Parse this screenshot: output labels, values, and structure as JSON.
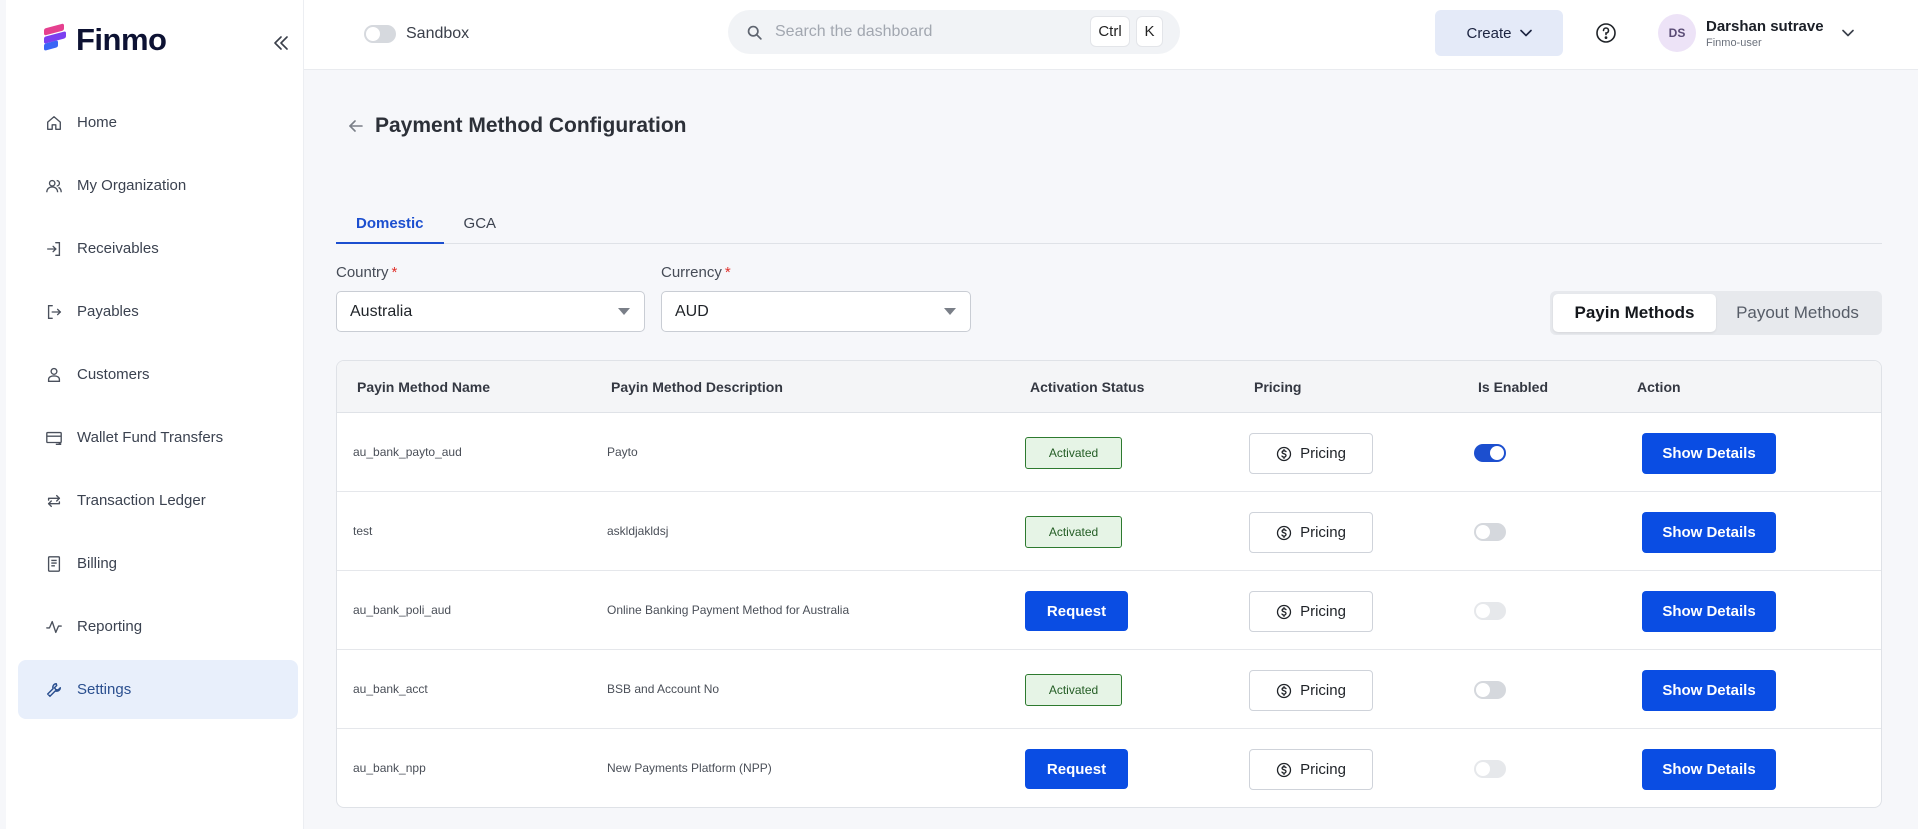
{
  "brand": {
    "name": "Finmo",
    "colors": {
      "primary": "#0a4de3",
      "logo_pink": "#e5408f",
      "logo_purple": "#7b3ff0",
      "logo_blue": "#3a66f5"
    }
  },
  "sidebar": {
    "collapse_icon": "double-chevron-left-icon",
    "items": [
      {
        "label": "Home",
        "icon": "home-icon",
        "active": false
      },
      {
        "label": "My Organization",
        "icon": "users-icon",
        "active": false
      },
      {
        "label": "Receivables",
        "icon": "sign-in-icon",
        "active": false
      },
      {
        "label": "Payables",
        "icon": "sign-out-icon",
        "active": false
      },
      {
        "label": "Customers",
        "icon": "user-icon",
        "active": false
      },
      {
        "label": "Wallet Fund Transfers",
        "icon": "wallet-transfer-icon",
        "active": false
      },
      {
        "label": "Transaction Ledger",
        "icon": "repeat-arrows-icon",
        "active": false
      },
      {
        "label": "Billing",
        "icon": "receipt-icon",
        "active": false
      },
      {
        "label": "Reporting",
        "icon": "activity-line-icon",
        "active": false
      },
      {
        "label": "Settings",
        "icon": "wrench-icon",
        "active": true
      }
    ]
  },
  "header": {
    "sandbox_label": "Sandbox",
    "search_placeholder": "Search the dashboard",
    "shortcut_keys": [
      "Ctrl",
      "K"
    ],
    "create_label": "Create",
    "user": {
      "initials": "DS",
      "name": "Darshan sutrave",
      "role": "Finmo-user"
    }
  },
  "page": {
    "title": "Payment Method Configuration",
    "tabs": [
      {
        "label": "Domestic",
        "active": true
      },
      {
        "label": "GCA",
        "active": false
      }
    ],
    "filters": {
      "country": {
        "label": "Country",
        "value": "Australia"
      },
      "currency": {
        "label": "Currency",
        "value": "AUD"
      }
    },
    "method_toggle": [
      {
        "label": "Payin Methods",
        "active": true
      },
      {
        "label": "Payout Methods",
        "active": false
      }
    ]
  },
  "table": {
    "headers": [
      "Payin Method Name",
      "Payin Method Description",
      "Activation Status",
      "Pricing",
      "Is Enabled",
      "Action"
    ],
    "rows": [
      {
        "name": "au_bank_payto_aud",
        "description": "Payto",
        "status": "activated",
        "status_label": "Activated",
        "pricing_label": "Pricing",
        "enabled": "on",
        "action_label": "Show Details"
      },
      {
        "name": "test",
        "description": "askldjakldsj",
        "status": "activated",
        "status_label": "Activated",
        "pricing_label": "Pricing",
        "enabled": "off",
        "action_label": "Show Details"
      },
      {
        "name": "au_bank_poli_aud",
        "description": "Online Banking Payment Method for Australia",
        "status": "request",
        "status_label": "Request",
        "pricing_label": "Pricing",
        "enabled": "disabled",
        "action_label": "Show Details"
      },
      {
        "name": "au_bank_acct",
        "description": "BSB and Account No",
        "status": "activated",
        "status_label": "Activated",
        "pricing_label": "Pricing",
        "enabled": "off",
        "action_label": "Show Details"
      },
      {
        "name": "au_bank_npp",
        "description": "New Payments Platform (NPP)",
        "status": "request",
        "status_label": "Request",
        "pricing_label": "Pricing",
        "enabled": "disabled",
        "action_label": "Show Details"
      }
    ]
  }
}
